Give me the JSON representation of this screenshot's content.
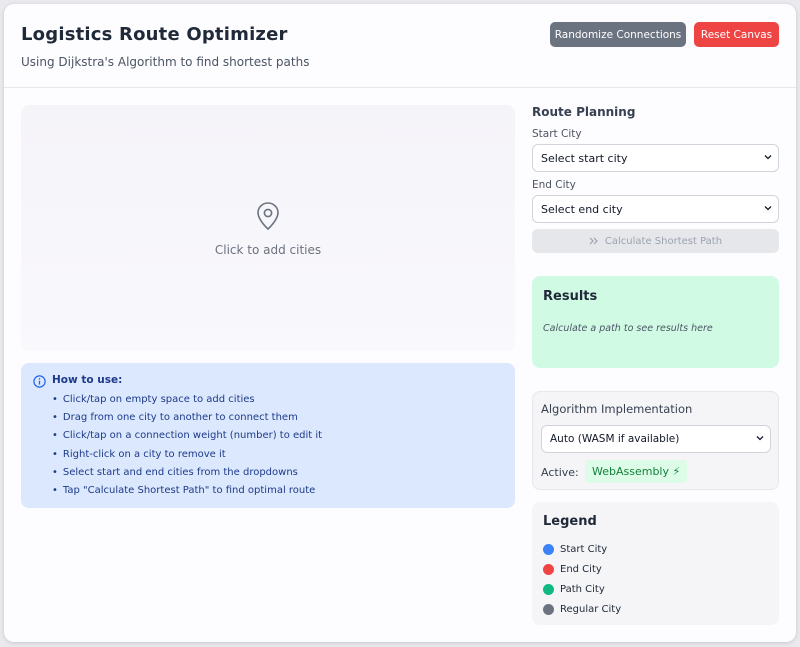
{
  "header": {
    "title": "Logistics Route Optimizer",
    "subtitle": "Using Dijkstra's Algorithm to find shortest paths",
    "randomize_label": "Randomize Connections",
    "reset_label": "Reset Canvas"
  },
  "canvas": {
    "hint": "Click to add cities",
    "icon": "map-pin-icon"
  },
  "howto": {
    "icon": "info-icon",
    "heading": "How to use:",
    "items": [
      "Click/tap on empty space to add cities",
      "Drag from one city to another to connect them",
      "Click/tap on a connection weight (number) to edit it",
      "Right-click on a city to remove it",
      "Select start and end cities from the dropdowns",
      "Tap \"Calculate Shortest Path\" to find optimal route"
    ]
  },
  "route_planning": {
    "title": "Route Planning",
    "start_label": "Start City",
    "start_value": "Select start city",
    "end_label": "End City",
    "end_value": "Select end city",
    "calculate_label": "Calculate Shortest Path",
    "calculate_icon": "double-chevron-right-icon"
  },
  "results": {
    "title": "Results",
    "placeholder": "Calculate a path to see results here"
  },
  "algorithm": {
    "title": "Algorithm Implementation",
    "selected": "Auto (WASM if available)",
    "active_label": "Active:",
    "active_value": "WebAssembly ⚡"
  },
  "legend": {
    "title": "Legend",
    "items": [
      {
        "label": "Start City",
        "color": "#3b82f6"
      },
      {
        "label": "End City",
        "color": "#ef4444"
      },
      {
        "label": "Path City",
        "color": "#10b981"
      },
      {
        "label": "Regular City",
        "color": "#6b7280"
      }
    ]
  },
  "colors": {
    "accent_reset": "#ef4444",
    "button_gray": "#6b7280",
    "results_bg": "#d1fae5",
    "info_bg": "#dbe8fd"
  }
}
